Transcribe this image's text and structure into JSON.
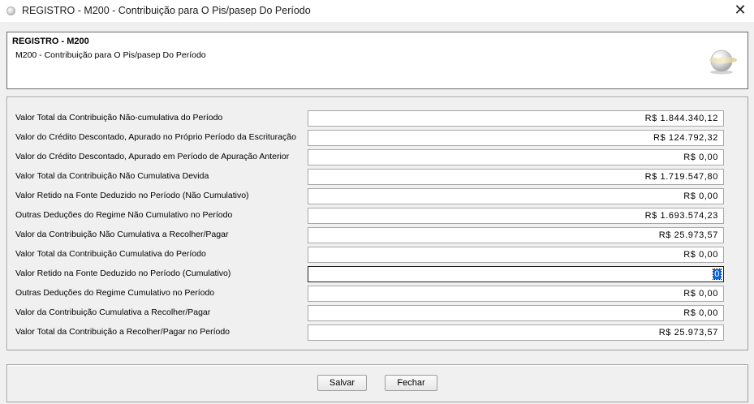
{
  "window": {
    "title": "REGISTRO - M200 - Contribuição para O Pis/pasep Do Período",
    "close_glyph": "✕"
  },
  "header": {
    "title": "REGISTRO - M200",
    "subtitle": "M200 - Contribuição para O Pis/pasep Do Período",
    "logo_icon": "globe-logo-icon"
  },
  "fields": [
    {
      "label": "Valor Total da Contribuição Não-cumulativa do Período",
      "value": "R$ 1.844.340,12"
    },
    {
      "label": "Valor do Crédito Descontado, Apurado no Próprio Período da Escrituração",
      "value": "R$ 124.792,32"
    },
    {
      "label": "Valor do Crédito Descontado, Apurado em Período de Apuração Anterior",
      "value": "R$ 0,00"
    },
    {
      "label": "Valor Total da Contribuição Não Cumulativa Devida",
      "value": "R$ 1.719.547,80"
    },
    {
      "label": "Valor Retido na Fonte Deduzido no Período (Não Cumulativo)",
      "value": "R$ 0,00"
    },
    {
      "label": "Outras Deduções do Regime Não Cumulativo no Período",
      "value": "R$ 1.693.574,23"
    },
    {
      "label": "Valor da Contribuição Não Cumulativa a Recolher/Pagar",
      "value": "R$ 25.973,57"
    },
    {
      "label": "Valor Total da Contribuição Cumulativa do Período",
      "value": "R$ 0,00"
    },
    {
      "label": "Valor Retido na Fonte Deduzido no Período (Cumulativo)",
      "value": "0",
      "focused": true
    },
    {
      "label": "Outras Deduções do Regime Cumulativo no Período",
      "value": "R$ 0,00"
    },
    {
      "label": "Valor da Contribuição Cumulativa a Recolher/Pagar",
      "value": "R$ 0,00"
    },
    {
      "label": "Valor Total da Contribuição a Recolher/Pagar no Período",
      "value": "R$ 25.973,57"
    }
  ],
  "buttons": {
    "save": "Salvar",
    "close": "Fechar"
  },
  "colors": {
    "selection": "#0a64d8",
    "window_bg": "#f0f0f0"
  }
}
